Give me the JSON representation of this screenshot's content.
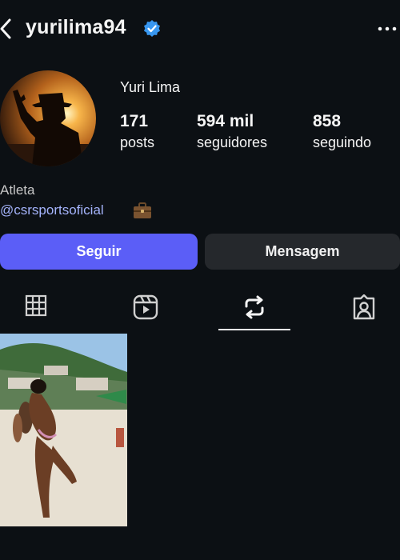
{
  "header": {
    "username": "yurilima94",
    "back_icon": "chevron-left-icon",
    "verified_icon": "verified-badge-icon",
    "verified_color": "#3897f0",
    "more_icon": "more-horizontal-icon"
  },
  "profile": {
    "display_name": "Yuri Lima",
    "stats": [
      {
        "value": "171",
        "label": "posts"
      },
      {
        "value": "594 mil",
        "label": "seguidores"
      },
      {
        "value": "858",
        "label": "seguindo"
      }
    ],
    "bio_category": "Atleta",
    "bio_link": "@csrsportsoficial",
    "bio_emoji_icon": "briefcase-icon"
  },
  "actions": {
    "follow_label": "Seguir",
    "message_label": "Mensagem",
    "follow_color": "#5b5ef7"
  },
  "tabs": [
    {
      "icon": "grid-icon",
      "active": false
    },
    {
      "icon": "reels-icon",
      "active": false
    },
    {
      "icon": "reposts-icon",
      "active": true
    },
    {
      "icon": "tagged-icon",
      "active": false
    }
  ]
}
